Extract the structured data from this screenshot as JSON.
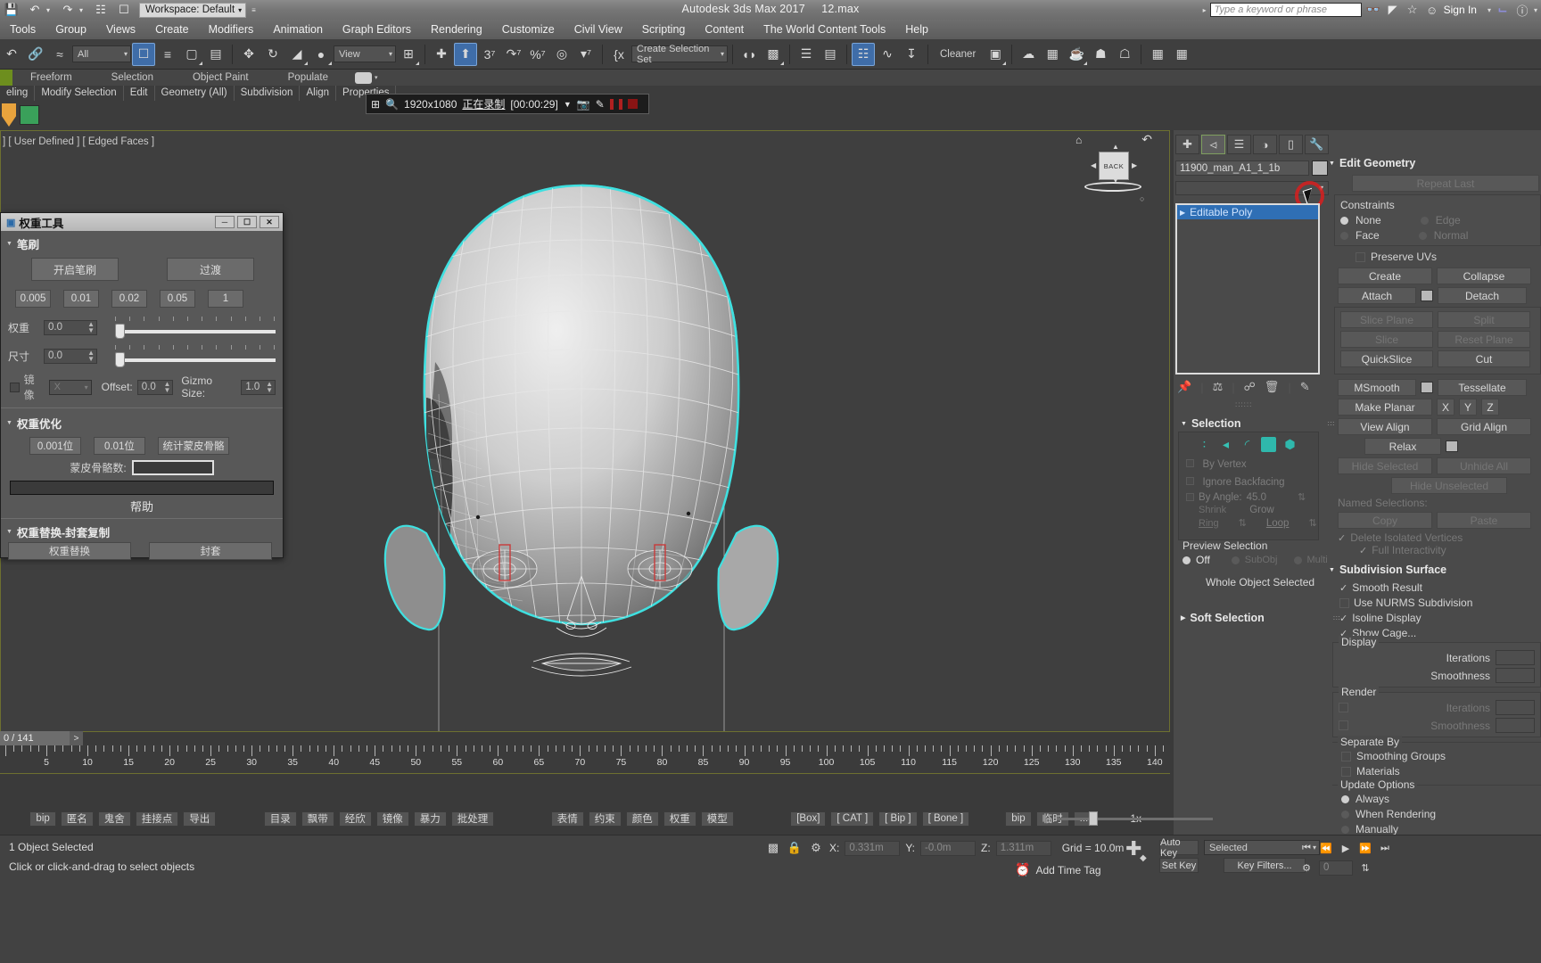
{
  "titlebar": {
    "workspace": "Workspace: Default",
    "app_title": "Autodesk 3ds Max 2017",
    "file_name": "12.max",
    "search_placeholder": "Type a keyword or phrase",
    "sign_in": "Sign In",
    "icons": [
      "save-icon",
      "undo-icon",
      "redo-icon",
      "link-icon",
      "window-icon"
    ]
  },
  "menu": [
    "Tools",
    "Group",
    "Views",
    "Create",
    "Modifiers",
    "Animation",
    "Graph Editors",
    "Rendering",
    "Customize",
    "Civil View",
    "Scripting",
    "Content",
    "The World Content Tools",
    "Help"
  ],
  "toolbar": {
    "filter_value": "All",
    "ref_coord_value": "View",
    "selection_set_value": "Create Selection Set",
    "cleaner_label": "Cleaner"
  },
  "ribbon": {
    "tabs": [
      "Freeform",
      "Selection",
      "Object Paint",
      "Populate"
    ],
    "subtabs": [
      "eling",
      "Modify Selection",
      "Edit",
      "Geometry (All)",
      "Subdivision",
      "Align",
      "Properties"
    ]
  },
  "recorder": {
    "resolution": "1920x1080",
    "status": "正在录制",
    "time": "[00:00:29]"
  },
  "viewport": {
    "label": "] [ User Defined ] [ Edged Faces ]",
    "viewcube_face": "BACK"
  },
  "weight_tool": {
    "title": "权重工具",
    "window_buttons": [
      "minimize",
      "restore",
      "close"
    ],
    "brush_section": "笔刷",
    "enable_brush": "开启笔刷",
    "blend": "过渡",
    "presets": [
      "0.005",
      "0.01",
      "0.02",
      "0.05",
      "1"
    ],
    "weight_label": "权重",
    "weight_value": "0.0",
    "size_label": "尺寸",
    "size_value": "0.0",
    "mirror_label": "镜像",
    "mirror_axis": "X",
    "offset_label": "Offset:",
    "offset_value": "0.0",
    "gizmo_label": "Gizmo Size:",
    "gizmo_value": "1.0",
    "optimize_section": "权重优化",
    "opt_btn1": "0.001位",
    "opt_btn2": "0.01位",
    "opt_btn3": "统计蒙皮骨骼",
    "bone_count_label": "蒙皮骨骼数:",
    "bone_count_value": "",
    "help": "帮助",
    "replace_section": "权重替换-封套复制",
    "replace_label": "权重替换",
    "envelope_label": "封套"
  },
  "command_panel": {
    "object_name": "11900_man_A1_1_1b",
    "modifier_stack": [
      "Editable Poly"
    ],
    "selection": {
      "title": "Selection",
      "by_vertex": "By Vertex",
      "ignore_backfacing": "Ignore Backfacing",
      "by_angle_label": "By Angle:",
      "by_angle_value": "45.0",
      "shrink": "Shrink",
      "grow": "Grow",
      "ring": "Ring",
      "loop": "Loop",
      "preview_selection": "Preview Selection",
      "off": "Off",
      "subobj": "SubObj",
      "multi": "Multi",
      "status": "Whole Object Selected"
    },
    "soft_selection": "Soft Selection",
    "edit_geometry": {
      "title": "Edit Geometry",
      "repeat_last": "Repeat Last",
      "constraints": "Constraints",
      "none": "None",
      "edge": "Edge",
      "face": "Face",
      "normal": "Normal",
      "preserve_uvs": "Preserve UVs",
      "create": "Create",
      "collapse": "Collapse",
      "attach": "Attach",
      "detach": "Detach",
      "slice_plane": "Slice Plane",
      "split": "Split",
      "slice": "Slice",
      "reset_plane": "Reset Plane",
      "quickslice": "QuickSlice",
      "cut": "Cut",
      "msmooth": "MSmooth",
      "tessellate": "Tessellate",
      "make_planar": "Make Planar",
      "view_align": "View Align",
      "grid_align": "Grid Align",
      "relax": "Relax",
      "hide_selected": "Hide Selected",
      "unhide_all": "Unhide All",
      "hide_unselected": "Hide Unselected",
      "named_selections": "Named Selections:",
      "copy": "Copy",
      "paste": "Paste",
      "delete_isolated": "Delete Isolated Vertices",
      "full_interactivity": "Full Interactivity"
    },
    "subdivision": {
      "title": "Subdivision Surface",
      "smooth_result": "Smooth Result",
      "use_nurms": "Use NURMS Subdivision",
      "isoline_display": "Isoline Display",
      "show_cage": "Show Cage...",
      "display": "Display",
      "iterations": "Iterations",
      "smoothness": "Smoothness",
      "render": "Render",
      "separate_by": "Separate By",
      "smoothing_groups": "Smoothing Groups",
      "materials": "Materials",
      "update_options": "Update Options",
      "always": "Always",
      "when_rendering": "When Rendering",
      "manually": "Manually"
    }
  },
  "timeline": {
    "frame_display": "0 / 141",
    "next_key": ">",
    "ticks": [
      5,
      10,
      15,
      20,
      25,
      30,
      35,
      40,
      45,
      50,
      55,
      60,
      65,
      70,
      75,
      80,
      85,
      90,
      95,
      100,
      105,
      110,
      115,
      120,
      125,
      130,
      135,
      140
    ]
  },
  "bottom_tools": {
    "group1": [
      "bip",
      "匿名",
      "鬼舍",
      "挂接点",
      "导出"
    ],
    "group2": [
      "目录",
      "飘带",
      "经欣",
      "镜像",
      "暴力",
      "批处理"
    ],
    "group3": [
      "表情",
      "约束",
      "颜色",
      "权重",
      "模型"
    ],
    "group4": [
      "[Box]",
      "[ CAT ]",
      "[ Bip ]",
      "[ Bone ]"
    ],
    "group5": [
      "bip",
      "临时",
      "..."
    ],
    "zoom_label": "1x"
  },
  "status": {
    "objects_selected": "1 Object Selected",
    "prompt": "Click or click-and-drag to select objects",
    "x_label": "X:",
    "x_value": "0.331m",
    "y_label": "Y:",
    "y_value": "-0.0m",
    "z_label": "Z:",
    "z_value": "1.311m",
    "grid_label": "Grid = 10.0m",
    "add_time_tag": "Add Time Tag",
    "auto_key": "Auto Key",
    "set_key": "Set Key",
    "selected_value": "Selected",
    "key_filters": "Key Filters...",
    "key_field": "0"
  },
  "colors": {
    "viewport_border": "#6d7030",
    "selection_cyan": "#3fe0e0",
    "accent_blue": "#2f6fb5",
    "highlight_red": "#d81f1f",
    "teal": "#2fb8ac"
  }
}
